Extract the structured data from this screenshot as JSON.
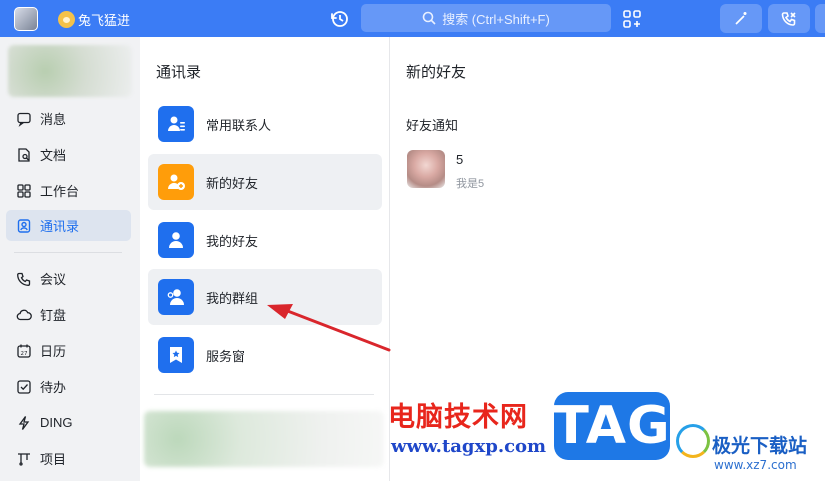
{
  "topbar": {
    "org_name": "兔飞猛进",
    "search_placeholder": "搜索 (Ctrl+Shift+F)"
  },
  "sidebar": {
    "items": [
      {
        "label": "消息",
        "icon": "message-icon"
      },
      {
        "label": "文档",
        "icon": "document-icon"
      },
      {
        "label": "工作台",
        "icon": "workbench-icon"
      },
      {
        "label": "通讯录",
        "icon": "contacts-icon",
        "active": true
      },
      {
        "label": "会议",
        "icon": "meeting-icon"
      },
      {
        "label": "钉盘",
        "icon": "cloud-drive-icon"
      },
      {
        "label": "日历",
        "icon": "calendar-icon",
        "badge": "27"
      },
      {
        "label": "待办",
        "icon": "todo-icon"
      },
      {
        "label": "DING",
        "icon": "ding-icon"
      },
      {
        "label": "项目",
        "icon": "project-icon"
      }
    ]
  },
  "contacts": {
    "title": "通讯录",
    "items": [
      {
        "label": "常用联系人",
        "icon": "frequent-contacts-icon"
      },
      {
        "label": "新的好友",
        "icon": "new-friend-icon",
        "selected": true
      },
      {
        "label": "我的好友",
        "icon": "my-friends-icon"
      },
      {
        "label": "我的群组",
        "icon": "my-groups-icon",
        "hovered": true
      },
      {
        "label": "服务窗",
        "icon": "service-window-icon"
      }
    ]
  },
  "detail": {
    "title": "新的好友",
    "section_label": "好友通知",
    "notifications": [
      {
        "name": "5",
        "message": "我是5"
      }
    ]
  },
  "watermark": {
    "cn_text": "电脑技术网",
    "url": "www.tagxp.com",
    "tag": "TAG",
    "site_name": "极光下载站",
    "site_url": "www.xz7.com"
  },
  "colors": {
    "topbar": "#3b7cf5",
    "accent": "#1f6fee",
    "new_friend_icon": "#ff9d0a",
    "annotation_arrow": "#d9262c"
  }
}
